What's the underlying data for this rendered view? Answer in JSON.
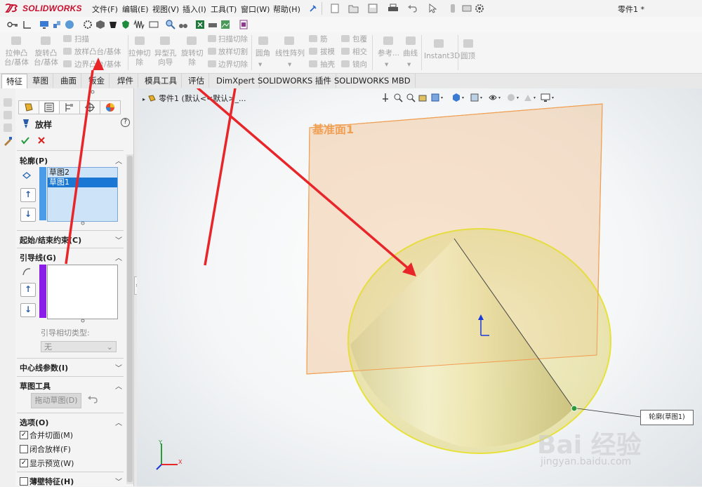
{
  "app": {
    "name": "SOLIDWORKS",
    "doc_title": "零件1 *"
  },
  "menu": [
    "文件(F)",
    "编辑(E)",
    "视图(V)",
    "插入(I)",
    "工具(T)",
    "窗口(W)",
    "帮助(H)"
  ],
  "commands": {
    "extrude_boss": "拉伸凸\n台/基体",
    "revolve_boss": "旋转凸\n台/基体",
    "sweep": "扫描",
    "loft": "放样凸台/基体",
    "boundary": "边界凸台/基体",
    "extrude_cut": "拉伸切\n除",
    "hole_wizard": "异型孔\n向导",
    "revolve_cut": "旋转切\n除",
    "swept_cut": "扫描切除",
    "lofted_cut": "放样切割",
    "boundary_cut": "边界切除",
    "fillet": "圆角",
    "linear_pattern": "线性阵列",
    "rib": "筋",
    "draft": "拔模",
    "shell": "抽壳",
    "wrap": "包覆",
    "intersect": "相交",
    "mirror": "镜向",
    "reference": "参考...",
    "curves": "曲线",
    "instant3d": "Instant3D",
    "dome": "圆顶"
  },
  "tabs": [
    "特征",
    "草图",
    "曲面",
    "钣金",
    "焊件",
    "模具工具",
    "评估",
    "DimXpert",
    "SOLIDWORKS 插件",
    "SOLIDWORKS MBD"
  ],
  "tree": {
    "root": "零件1  (默认<<默认>_..."
  },
  "property_manager": {
    "title": "放样",
    "help": "?",
    "profiles": {
      "header": "轮廓(P)",
      "items": [
        "草图2",
        "草图1"
      ],
      "selected": 1
    },
    "start_end": "起始/结束约束(C)",
    "guides": {
      "header": "引导线(G)",
      "tangency_label": "引导相切类型:",
      "tangency_value": "无"
    },
    "centerline": "中心线参数(I)",
    "sketch_tools": {
      "header": "草图工具",
      "drag_button": "拖动草图(D)"
    },
    "options": {
      "header": "选项(O)",
      "merge_tangent": {
        "label": "合并切面(M)",
        "checked": true
      },
      "close_loft": {
        "label": "闭合放样(F)",
        "checked": false
      },
      "show_preview": {
        "label": "显示预览(W)",
        "checked": true
      }
    },
    "thin_feature": {
      "label": "薄壁特征(H)",
      "checked": false
    }
  },
  "viewport": {
    "plane_label": "基准面1",
    "callout": "轮廓(草图1)",
    "axis_x": "X",
    "axis_y": "Y",
    "watermark": "Bai 经验",
    "watermark_url": "jingyan.baidu.com"
  },
  "colors": {
    "accent_red": "#e8262a",
    "plane": "#f0a055",
    "cone": "#e8e2a0",
    "selection": "#1a78d4"
  }
}
